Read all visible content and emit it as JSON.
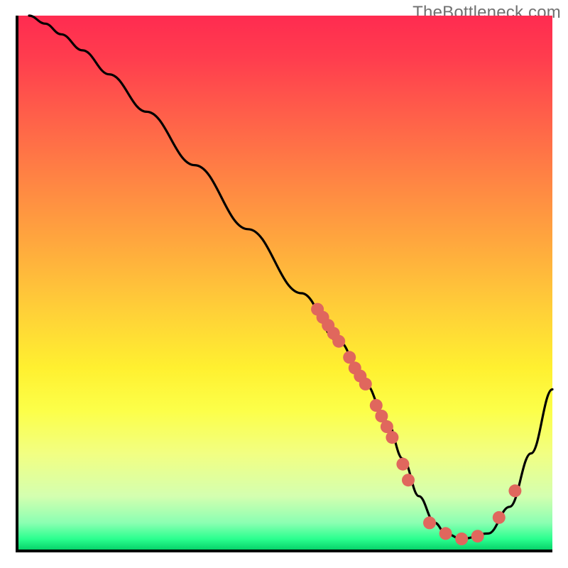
{
  "watermark": "TheBottleneck.com",
  "chart_data": {
    "type": "line",
    "title": "",
    "xlabel": "",
    "ylabel": "",
    "xlim": [
      0,
      100
    ],
    "ylim": [
      0,
      100
    ],
    "grid": false,
    "legend": false,
    "axes_visible": {
      "left": true,
      "bottom": true,
      "top": false,
      "right": false
    },
    "tick_labels": {
      "x": [],
      "y": []
    },
    "series": [
      {
        "name": "curve",
        "type": "line",
        "x": [
          2,
          5,
          8,
          12,
          17,
          24,
          33,
          43,
          53,
          60,
          65,
          69,
          72,
          75,
          78,
          80,
          83,
          88,
          92,
          96,
          100
        ],
        "y": [
          100,
          98.5,
          96.5,
          93.5,
          89,
          82,
          72,
          60,
          48,
          39,
          31,
          24,
          17,
          10,
          5,
          3,
          2,
          3,
          8,
          18,
          30
        ]
      },
      {
        "name": "cluster-upper",
        "type": "scatter",
        "x": [
          56,
          57,
          58,
          59,
          60,
          62,
          63,
          64,
          65,
          67,
          68,
          69,
          70,
          72,
          73
        ],
        "y": [
          45,
          43.5,
          42,
          40.5,
          39,
          36,
          34,
          32.5,
          31,
          27,
          25,
          23,
          21,
          16,
          13
        ]
      },
      {
        "name": "cluster-bottom",
        "type": "scatter",
        "x": [
          77,
          80,
          83,
          86
        ],
        "y": [
          5,
          3,
          2,
          2.5
        ]
      },
      {
        "name": "cluster-right",
        "type": "scatter",
        "x": [
          90,
          93
        ],
        "y": [
          6,
          11
        ]
      }
    ]
  }
}
